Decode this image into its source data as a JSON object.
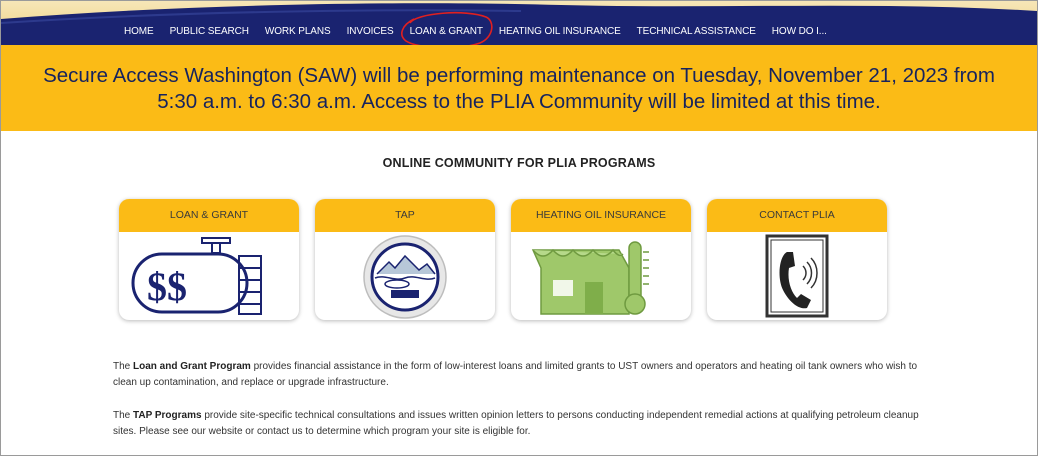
{
  "nav": {
    "items": [
      "HOME",
      "PUBLIC SEARCH",
      "WORK PLANS",
      "INVOICES",
      "LOAN & GRANT",
      "HEATING OIL INSURANCE",
      "TECHNICAL ASSISTANCE",
      "HOW DO I..."
    ],
    "circled_item": "LOAN & GRANT"
  },
  "banner": {
    "line1": "Secure Access Washington (SAW) will be performing maintenance on Tuesday, November 21, 2023 from",
    "line2": "5:30 a.m. to 6:30 a.m. Access to the PLIA Community will be limited at this time."
  },
  "section_title": "ONLINE COMMUNITY FOR PLIA PROGRAMS",
  "cards": [
    {
      "title": "LOAN & GRANT",
      "icon": "oil-tank-dollar-icon",
      "icon_text": "$$"
    },
    {
      "title": "TAP",
      "icon": "tap-seal-icon"
    },
    {
      "title": "HEATING OIL INSURANCE",
      "icon": "house-thermometer-icon"
    },
    {
      "title": "CONTACT PLIA",
      "icon": "telephone-icon"
    }
  ],
  "paragraphs": {
    "loan": {
      "prefix": "The ",
      "bold": "Loan and Grant Program",
      "text": " provides financial assistance in the form of low-interest loans and limited grants to UST owners and operators and heating oil tank owners who wish to clean up contamination, and replace or upgrade infrastructure."
    },
    "tap": {
      "prefix": "The ",
      "bold": "TAP Programs",
      "text": " provide site-specific technical consultations and issues written opinion letters to persons conducting independent remedial actions at qualifying petroleum cleanup sites. Please see our website or contact us to determine which program your site is eligible for."
    }
  },
  "colors": {
    "navy": "#1a2370",
    "gold": "#fbbb16",
    "annotation_red": "#e02020",
    "house_green": "#9fc86a"
  }
}
